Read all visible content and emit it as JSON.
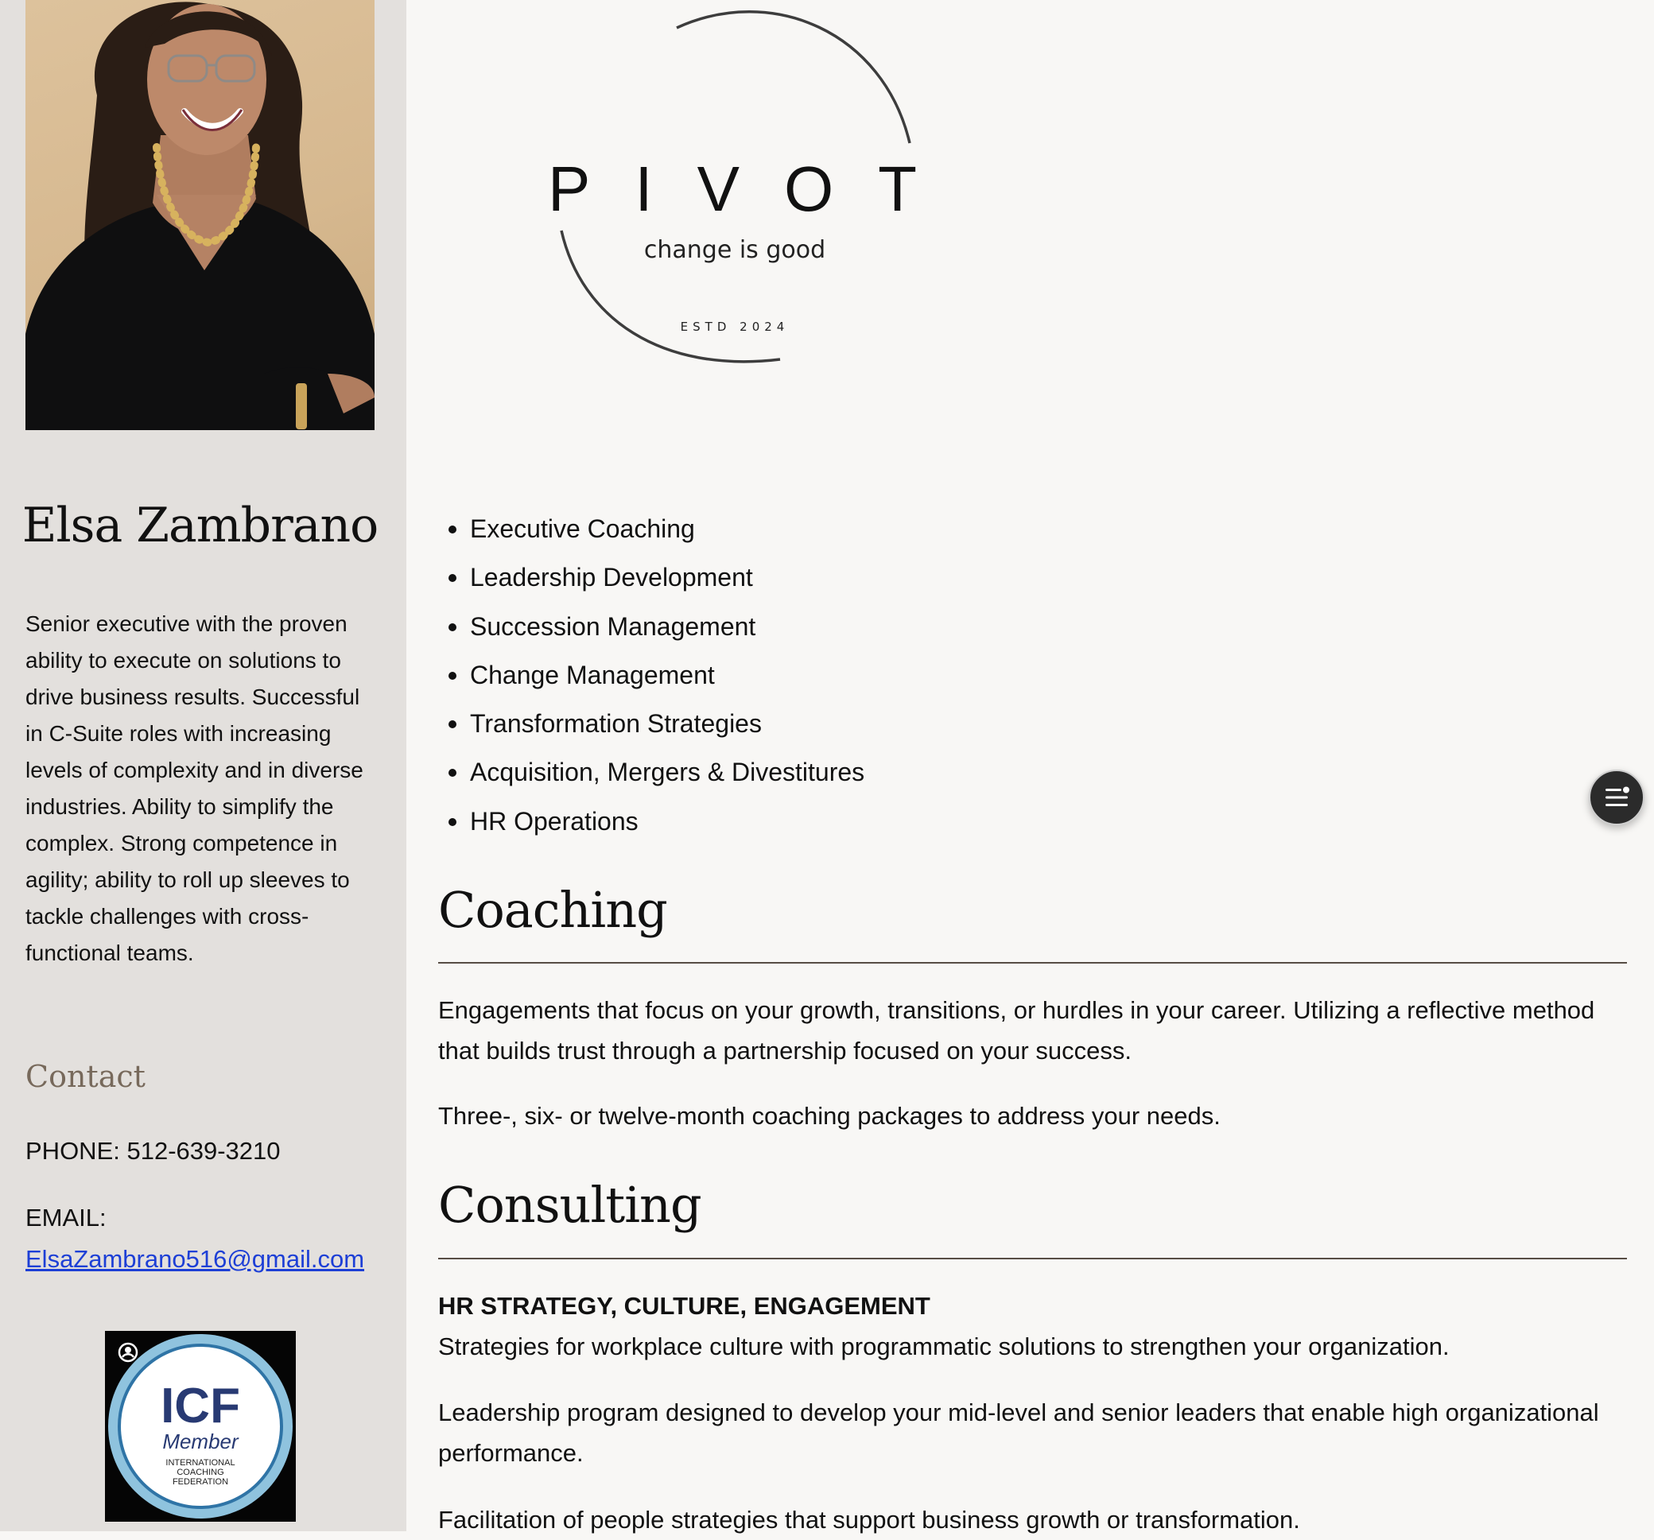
{
  "sidebar": {
    "name": "Elsa Zambrano",
    "bio": "Senior executive with the proven ability to execute on solutions to drive business results. Successful in C-Suite roles with increasing levels of complexity and in diverse industries. Ability to simplify the complex. Strong competence in agility; ability to roll up sleeves to tackle challenges with cross-functional teams.",
    "contact_heading": "Contact",
    "phone": "PHONE: 512-639-3210",
    "email_label": "EMAIL:",
    "email": "ElsaZambrano516@gmail.com",
    "badge": {
      "title": "ICF",
      "subtitle": "Member",
      "org_line1": "INTERNATIONAL",
      "org_line2": "COACHING",
      "org_line3": "FEDERATION"
    }
  },
  "logo": {
    "wordmark": "PIVOT",
    "tagline": "change is good",
    "established": "ESTD 2024"
  },
  "services": [
    "Executive Coaching",
    "Leadership Development",
    "Succession Management",
    "Change Management",
    "Transformation Strategies",
    "Acquisition, Mergers & Divestitures",
    "HR Operations"
  ],
  "coaching": {
    "heading": "Coaching",
    "p1": "Engagements that focus on your growth, transitions, or hurdles in your career. Utilizing a reflective method that builds trust through a partnership focused on your success.",
    "p2": "Three-, six- or twelve-month coaching packages to address your needs."
  },
  "consulting": {
    "heading": "Consulting",
    "subheading": "HR STRATEGY, CULTURE, ENGAGEMENT",
    "p1": "Strategies for workplace culture with programmatic solutions to strengthen your organization.",
    "p2": "Leadership program designed to develop your mid-level and senior leaders that enable high organizational performance.",
    "p3": "Facilitation of people strategies that support business growth or transformation."
  },
  "fab": {
    "icon": "menu-icon"
  }
}
